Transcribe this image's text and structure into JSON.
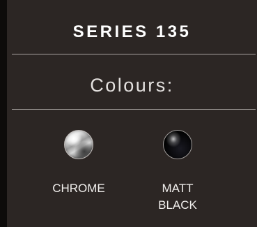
{
  "header": {
    "title": "SERIES 135"
  },
  "colours": {
    "heading": "Colours:",
    "options": [
      {
        "line1": "CHROME",
        "line2": "",
        "swatch": "chrome-swatch",
        "color": "#cfcfcf"
      },
      {
        "line1": "MATT",
        "line2": "BLACK",
        "swatch": "matt-black-swatch",
        "color": "#050508"
      }
    ]
  },
  "theme": {
    "panel_bg": "#2c2624",
    "page_bg": "#0d0b0a",
    "text": "#ffffff",
    "divider": "#a7a29f"
  }
}
